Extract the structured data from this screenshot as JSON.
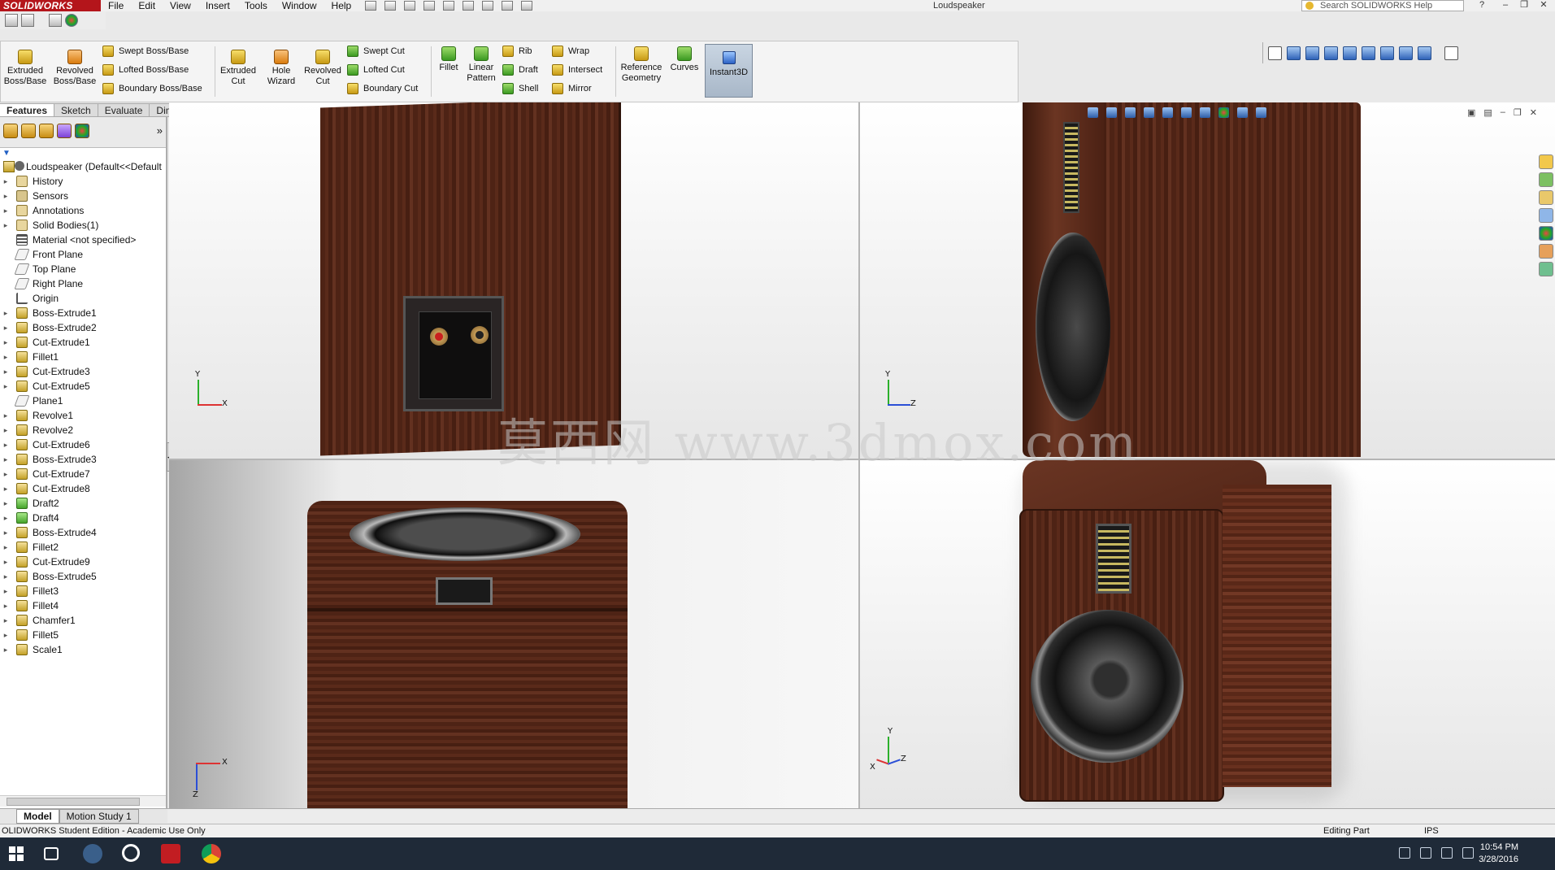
{
  "app": {
    "name": "SOLIDWORKS",
    "title": "Loudspeaker",
    "search_placeholder": "Search SOLIDWORKS Help",
    "menu": [
      "File",
      "Edit",
      "View",
      "Insert",
      "Tools",
      "Window",
      "Help"
    ]
  },
  "command_manager": {
    "buttons": {
      "extruded_boss": "Extruded Boss/Base",
      "revolved_boss": "Revolved Boss/Base",
      "swept_boss": "Swept Boss/Base",
      "lofted_boss": "Lofted Boss/Base",
      "boundary_boss": "Boundary Boss/Base",
      "extruded_cut": "Extruded Cut",
      "hole_wizard": "Hole Wizard",
      "revolved_cut": "Revolved Cut",
      "swept_cut": "Swept Cut",
      "lofted_cut": "Lofted Cut",
      "boundary_cut": "Boundary Cut",
      "fillet": "Fillet",
      "linear_pattern": "Linear Pattern",
      "rib": "Rib",
      "draft": "Draft",
      "shell": "Shell",
      "wrap": "Wrap",
      "intersect": "Intersect",
      "mirror": "Mirror",
      "reference_geometry": "Reference Geometry",
      "curves": "Curves",
      "instant3d": "Instant3D"
    },
    "tabs": [
      "Features",
      "Sketch",
      "Evaluate",
      "DimXpert"
    ]
  },
  "feature_tree": {
    "root": "Loudspeaker  (Default<<Default",
    "items": [
      {
        "label": "History",
        "icon": "folder"
      },
      {
        "label": "Sensors",
        "icon": "sensor"
      },
      {
        "label": "Annotations",
        "icon": "folder"
      },
      {
        "label": "Solid Bodies(1)",
        "icon": "folder"
      },
      {
        "label": "Material <not specified>",
        "icon": "material"
      },
      {
        "label": "Front Plane",
        "icon": "plane"
      },
      {
        "label": "Top Plane",
        "icon": "plane"
      },
      {
        "label": "Right Plane",
        "icon": "plane"
      },
      {
        "label": "Origin",
        "icon": "origin"
      },
      {
        "label": "Boss-Extrude1",
        "icon": "feat"
      },
      {
        "label": "Boss-Extrude2",
        "icon": "feat"
      },
      {
        "label": "Cut-Extrude1",
        "icon": "feat"
      },
      {
        "label": "Fillet1",
        "icon": "feat"
      },
      {
        "label": "Cut-Extrude3",
        "icon": "feat"
      },
      {
        "label": "Cut-Extrude5",
        "icon": "feat"
      },
      {
        "label": "Plane1",
        "icon": "plane"
      },
      {
        "label": "Revolve1",
        "icon": "feat"
      },
      {
        "label": "Revolve2",
        "icon": "feat"
      },
      {
        "label": "Cut-Extrude6",
        "icon": "feat"
      },
      {
        "label": "Boss-Extrude3",
        "icon": "feat"
      },
      {
        "label": "Cut-Extrude7",
        "icon": "feat"
      },
      {
        "label": "Cut-Extrude8",
        "icon": "feat"
      },
      {
        "label": "Draft2",
        "icon": "green"
      },
      {
        "label": "Draft4",
        "icon": "green"
      },
      {
        "label": "Boss-Extrude4",
        "icon": "feat"
      },
      {
        "label": "Fillet2",
        "icon": "feat"
      },
      {
        "label": "Cut-Extrude9",
        "icon": "feat"
      },
      {
        "label": "Boss-Extrude5",
        "icon": "feat"
      },
      {
        "label": "Fillet3",
        "icon": "feat"
      },
      {
        "label": "Fillet4",
        "icon": "feat"
      },
      {
        "label": "Chamfer1",
        "icon": "feat"
      },
      {
        "label": "Fillet5",
        "icon": "feat"
      },
      {
        "label": "Scale1",
        "icon": "feat"
      }
    ]
  },
  "bottom_tabs": [
    "Model",
    "Motion Study 1"
  ],
  "viewports": {
    "triad_labels": {
      "x": "X",
      "y": "Y",
      "z": "Z"
    }
  },
  "watermark": "莫西网 www.3dmox.com",
  "status": {
    "left": "OLIDWORKS Student Edition - Academic Use Only",
    "mode": "Editing Part",
    "units": "IPS"
  },
  "taskbar": {
    "time": "10:54 PM",
    "date": "3/28/2016"
  },
  "colors": {
    "brand": "#b4151b",
    "wood": "#5a2a1a",
    "taskbar": "#1f2a38"
  }
}
